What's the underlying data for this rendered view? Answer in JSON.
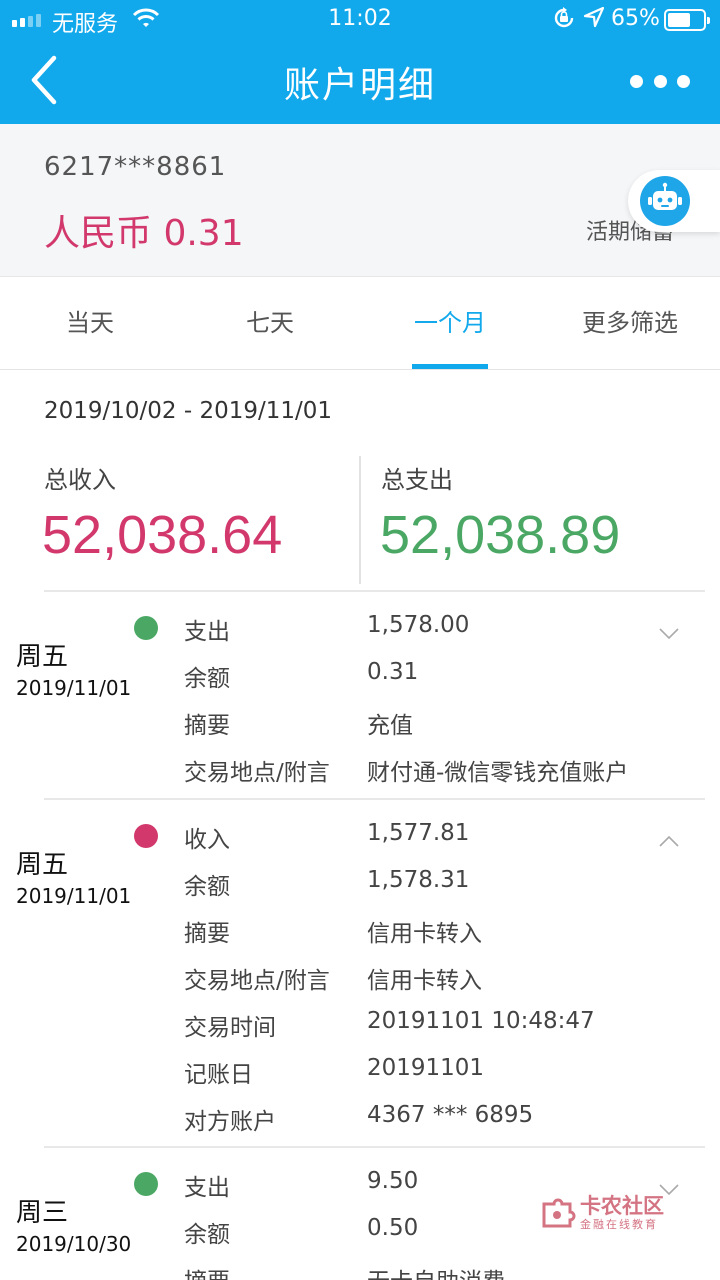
{
  "status_bar": {
    "carrier": "无服务",
    "time": "11:02",
    "battery": "65%",
    "battery_level": 0.65,
    "icons": [
      "signal-icon",
      "wifi-icon",
      "rotation-lock-icon",
      "location-icon",
      "battery-icon"
    ]
  },
  "nav": {
    "title": "账户明细",
    "icons": [
      "back-arrow-icon",
      "more-dots-icon"
    ]
  },
  "account": {
    "number": "6217***8861",
    "balance": "人民币 0.31",
    "type": "活期储蓄",
    "assistant_icon": "robot-icon"
  },
  "tabs": [
    {
      "label": "当天",
      "active": false
    },
    {
      "label": "七天",
      "active": false
    },
    {
      "label": "一个月",
      "active": true
    },
    {
      "label": "更多筛选",
      "active": false
    }
  ],
  "summary": {
    "date_range": "2019/10/02 - 2019/11/01",
    "income_label": "总收入",
    "income_value": "52,038.64",
    "expense_label": "总支出",
    "expense_value": "52,038.89"
  },
  "colors": {
    "brand": "#12a9ec",
    "income": "#d2386b",
    "expense": "#4aa764"
  },
  "records": [
    {
      "weekday": "周五",
      "date": "2019/11/01",
      "kind": "expense",
      "expanded": false,
      "rows": [
        {
          "label": "支出",
          "value": "1,578.00"
        },
        {
          "label": "余额",
          "value": "0.31"
        },
        {
          "label": "摘要",
          "value": "充值"
        },
        {
          "label": "交易地点/附言",
          "value": "财付通-微信零钱充值账户"
        }
      ]
    },
    {
      "weekday": "周五",
      "date": "2019/11/01",
      "kind": "income",
      "expanded": true,
      "rows": [
        {
          "label": "收入",
          "value": "1,577.81"
        },
        {
          "label": "余额",
          "value": "1,578.31"
        },
        {
          "label": "摘要",
          "value": "信用卡转入"
        },
        {
          "label": "交易地点/附言",
          "value": "信用卡转入"
        },
        {
          "label": "交易时间",
          "value": "20191101 10:48:47"
        },
        {
          "label": "记账日",
          "value": "20191101"
        },
        {
          "label": "对方账户",
          "value": "4367 *** 6895"
        }
      ]
    },
    {
      "weekday": "周三",
      "date": "2019/10/30",
      "kind": "expense",
      "expanded": false,
      "rows": [
        {
          "label": "支出",
          "value": "9.50"
        },
        {
          "label": "余额",
          "value": "0.50"
        },
        {
          "label": "摘要",
          "value": "无卡自助消费"
        }
      ]
    }
  ],
  "watermark": {
    "name": "卡农社区",
    "slogan": "金融在线教育"
  }
}
